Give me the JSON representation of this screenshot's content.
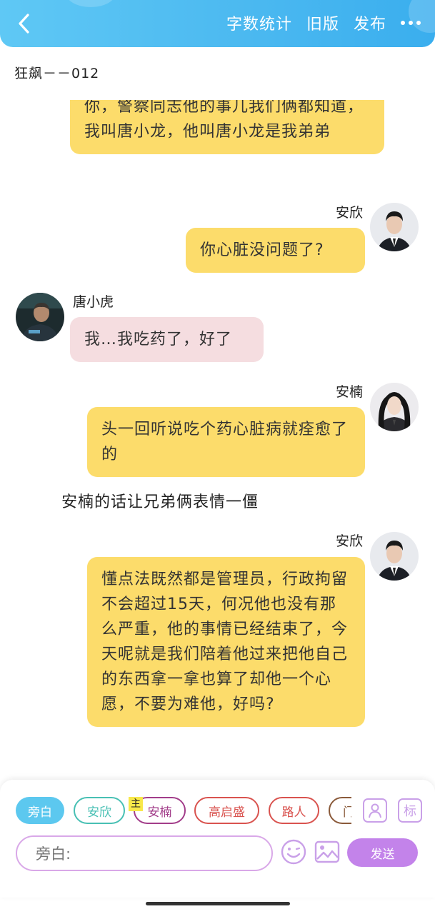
{
  "header": {
    "actions": [
      "字数统计",
      "旧版",
      "发布"
    ]
  },
  "chapter_title": "狂飙－－012",
  "messages": [
    {
      "text": "你，警察同志他的事儿我们俩都知道，我叫唐小龙，他叫唐小龙是我弟弟"
    },
    {
      "speaker": "安欣",
      "text": "你心脏没问题了?"
    },
    {
      "speaker": "唐小虎",
      "text": "我…我吃药了，好了"
    },
    {
      "speaker": "安楠",
      "text": "头一回听说吃个药心脏病就痊愈了的"
    },
    {
      "narration": "安楠的话让兄弟俩表情一僵"
    },
    {
      "speaker": "安欣",
      "text": "懂点法既然都是管理员，行政拘留不会超过15天，何况他也没有那么严重，他的事情已经结束了，今天呢就是我们陪着他过来把他自己的东西拿一拿也算了却他一个心愿，不要为难他，好吗?"
    }
  ],
  "composer": {
    "roles": [
      "旁白",
      "安欣",
      "安楠",
      "高启盛",
      "路人",
      "门"
    ],
    "main_tag": "主",
    "mark_label": "标",
    "input_prefix": "旁白:",
    "send_label": "发送"
  },
  "colors": {
    "header": "#4ab8f0",
    "bubble_self": "#fcdc6b",
    "bubble_other": "#f5dde0",
    "send": "#c383ea"
  }
}
